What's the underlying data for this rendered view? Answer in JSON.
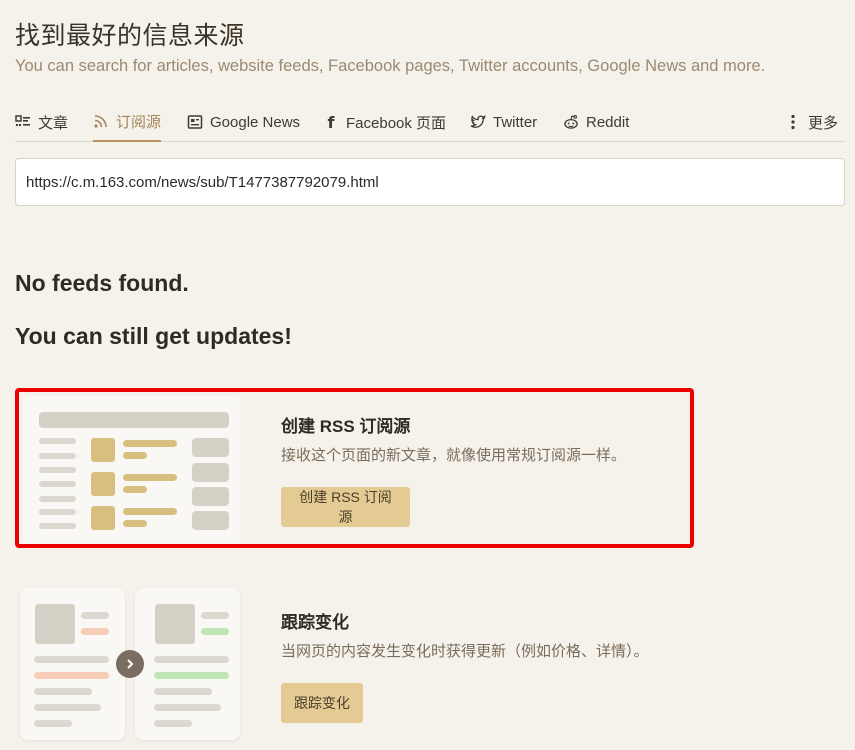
{
  "page": {
    "title": "找到最好的信息来源",
    "subtitle": "You can search for articles, website feeds, Facebook pages, Twitter accounts, Google News and more."
  },
  "tabs": [
    {
      "label": "文章",
      "icon": "article-list-icon",
      "active": false
    },
    {
      "label": "订阅源",
      "icon": "rss-icon",
      "active": true
    },
    {
      "label": "Google News",
      "icon": "newspaper-icon",
      "active": false
    },
    {
      "label": "Facebook 页面",
      "icon": "facebook-icon",
      "active": false
    },
    {
      "label": "Twitter",
      "icon": "twitter-bird-icon",
      "active": false
    },
    {
      "label": "Reddit",
      "icon": "reddit-icon",
      "active": false
    }
  ],
  "more": {
    "label": "更多",
    "icon": "vertical-dots-icon"
  },
  "search": {
    "value": "https://c.m.163.com/news/sub/T1477387792079.html"
  },
  "results": {
    "empty_heading": "No feeds found.",
    "updates_heading": "You can still get updates!"
  },
  "option_rss": {
    "title": "创建 RSS 订阅源",
    "description": "接收这个页面的新文章，就像使用常规订阅源一样。",
    "button": "创建 RSS 订阅源"
  },
  "option_track": {
    "title": "跟踪变化",
    "description": "当网页的内容发生变化时获得更新（例如价格、详情）。",
    "button": "跟踪变化"
  },
  "colors": {
    "accent": "#b8925a",
    "button_bg": "#e4cb93",
    "highlight_border": "#ee0000",
    "background": "#f5f1eb"
  }
}
